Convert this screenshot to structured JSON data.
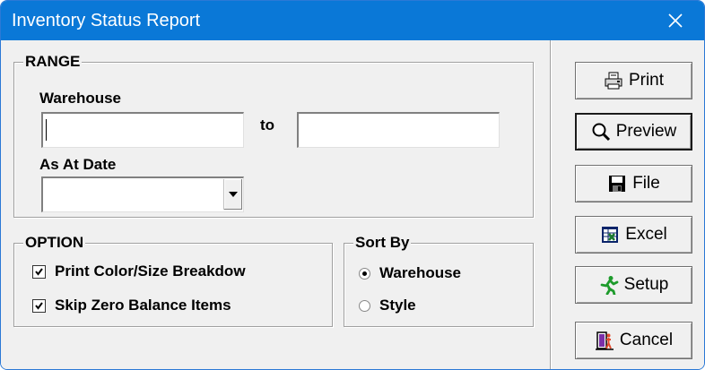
{
  "window": {
    "title": "Inventory Status Report"
  },
  "range": {
    "legend": "RANGE",
    "warehouse_label": "Warehouse",
    "warehouse_from": "",
    "to_label": "to",
    "warehouse_to": "",
    "date_label": "As At Date",
    "date_value": ""
  },
  "option": {
    "legend": "OPTION",
    "print_color_size": {
      "label": "Print Color/Size Breakdow",
      "checked": true
    },
    "skip_zero": {
      "label": "Skip Zero Balance Items",
      "checked": true
    }
  },
  "sort_by": {
    "legend": "Sort By",
    "options": [
      {
        "label": "Warehouse",
        "selected": true
      },
      {
        "label": "Style",
        "selected": false
      }
    ]
  },
  "buttons": {
    "print": "Print",
    "preview": "Preview",
    "file": "File",
    "excel": "Excel",
    "setup": "Setup",
    "cancel": "Cancel"
  }
}
